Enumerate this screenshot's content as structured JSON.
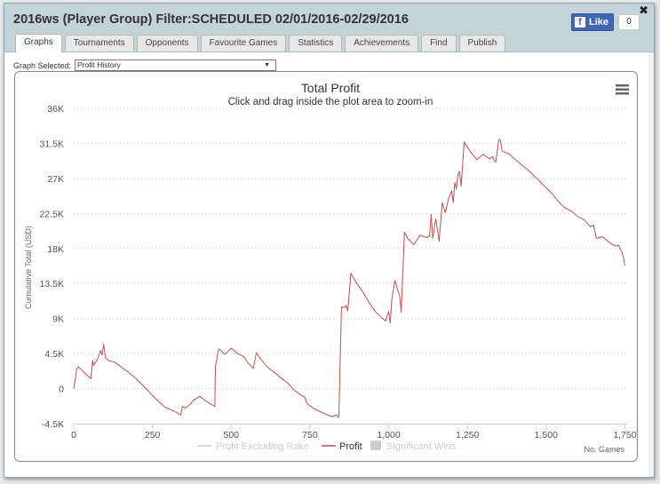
{
  "window": {
    "title": "2016ws (Player Group) Filter:SCHEDULED 02/01/2016-02/29/2016",
    "close_symbol": "✖"
  },
  "facebook": {
    "like_label": "Like",
    "count": "0",
    "logo": "f"
  },
  "tabs": [
    {
      "label": "Graphs",
      "active": true
    },
    {
      "label": "Tournaments",
      "active": false
    },
    {
      "label": "Opponents",
      "active": false
    },
    {
      "label": "Favourite Games",
      "active": false
    },
    {
      "label": "Statistics",
      "active": false
    },
    {
      "label": "Achievements",
      "active": false
    },
    {
      "label": "Find",
      "active": false
    },
    {
      "label": "Publish",
      "active": false
    }
  ],
  "graph_select": {
    "label": "Graph Selected:",
    "value": "Profit History"
  },
  "colors": {
    "profit": "#c0504d",
    "grid": "#cccccc",
    "legend_disabled": "#cccccc"
  },
  "chart_data": {
    "type": "line",
    "title": "Total Profit",
    "subtitle": "Click and drag inside the plot area to zoom-in",
    "xlabel": "No. Games",
    "ylabel": "Cumulative Total (USD)",
    "xlim": [
      0,
      1760
    ],
    "ylim": [
      -4500,
      36000
    ],
    "x_ticks": [
      0,
      250,
      500,
      750,
      1000,
      1250,
      1500,
      1750
    ],
    "x_tick_labels": [
      "0",
      "250",
      "500",
      "750",
      "1,000",
      "1,250",
      "1,500",
      "1,750"
    ],
    "y_ticks": [
      -4500,
      0,
      4500,
      9000,
      13500,
      18000,
      22500,
      27000,
      31500,
      36000
    ],
    "y_tick_labels": [
      "-4.5K",
      "0",
      "4.5K",
      "9K",
      "13.5K",
      "18K",
      "22.5K",
      "27K",
      "31.5K",
      "36K"
    ],
    "grid": "horizontal dotted",
    "legend_position": "bottom-center",
    "legend": [
      {
        "label": "Profit Excluding Rake",
        "symbol": "line",
        "enabled": false
      },
      {
        "label": "Profit",
        "symbol": "line",
        "enabled": true
      },
      {
        "label": "Significant Wins",
        "symbol": "box",
        "enabled": false
      }
    ],
    "series": [
      {
        "name": "Profit",
        "color": "#c0504d",
        "x": [
          0,
          10,
          15,
          30,
          45,
          55,
          60,
          62,
          75,
          85,
          90,
          95,
          100,
          110,
          130,
          150,
          170,
          200,
          230,
          260,
          290,
          320,
          340,
          345,
          355,
          370,
          380,
          400,
          420,
          440,
          448,
          450,
          460,
          470,
          480,
          500,
          520,
          540,
          548,
          555,
          570,
          580,
          590,
          600,
          610,
          620,
          640,
          660,
          680,
          700,
          720,
          735,
          740,
          750,
          760,
          780,
          800,
          820,
          835,
          840,
          842,
          850,
          860,
          865,
          870,
          880,
          900,
          920,
          940,
          960,
          980,
          990,
          1000,
          1005,
          1010,
          1020,
          1035,
          1040,
          1050,
          1060,
          1080,
          1100,
          1120,
          1130,
          1135,
          1140,
          1150,
          1160,
          1170,
          1180,
          1190,
          1200,
          1205,
          1210,
          1215,
          1220,
          1225,
          1230,
          1240,
          1260,
          1280,
          1300,
          1320,
          1330,
          1335,
          1340,
          1350,
          1355,
          1360,
          1380,
          1400,
          1420,
          1440,
          1460,
          1480,
          1500,
          1520,
          1540,
          1560,
          1580,
          1600,
          1620,
          1640,
          1650,
          1660,
          1680,
          1700,
          1720,
          1730,
          1740,
          1745,
          1750
        ],
        "y": [
          0,
          2500,
          2800,
          2200,
          1600,
          1300,
          3600,
          3000,
          3700,
          4900,
          4300,
          5700,
          4000,
          3600,
          3400,
          2800,
          2200,
          1200,
          0,
          -1300,
          -2400,
          -2900,
          -3400,
          -2300,
          -2500,
          -2000,
          -1500,
          -1000,
          -1600,
          -2100,
          -2300,
          2800,
          5100,
          4800,
          4400,
          5200,
          4500,
          4100,
          3600,
          3200,
          2600,
          4600,
          4000,
          3500,
          3000,
          2600,
          2000,
          1300,
          700,
          -200,
          -800,
          -1200,
          -1900,
          -2200,
          -2500,
          -2900,
          -3300,
          -3600,
          -3400,
          -3700,
          -3600,
          10500,
          10400,
          10700,
          10000,
          14800,
          13400,
          12300,
          10900,
          9800,
          9000,
          8700,
          9900,
          8400,
          11500,
          13900,
          11800,
          9800,
          20100,
          19300,
          18500,
          19700,
          19400,
          19600,
          22400,
          19300,
          21800,
          18900,
          23900,
          22600,
          24400,
          25400,
          23900,
          26500,
          25600,
          27500,
          27900,
          26000,
          31700,
          30400,
          29400,
          30100,
          29500,
          29800,
          29300,
          29100,
          32000,
          31900,
          30500,
          30200,
          29500,
          28800,
          28200,
          27400,
          26600,
          25800,
          25000,
          24000,
          23200,
          22800,
          22100,
          21700,
          20800,
          21000,
          19300,
          19500,
          18800,
          18300,
          18400,
          17600,
          16900,
          15800
        ]
      }
    ]
  }
}
